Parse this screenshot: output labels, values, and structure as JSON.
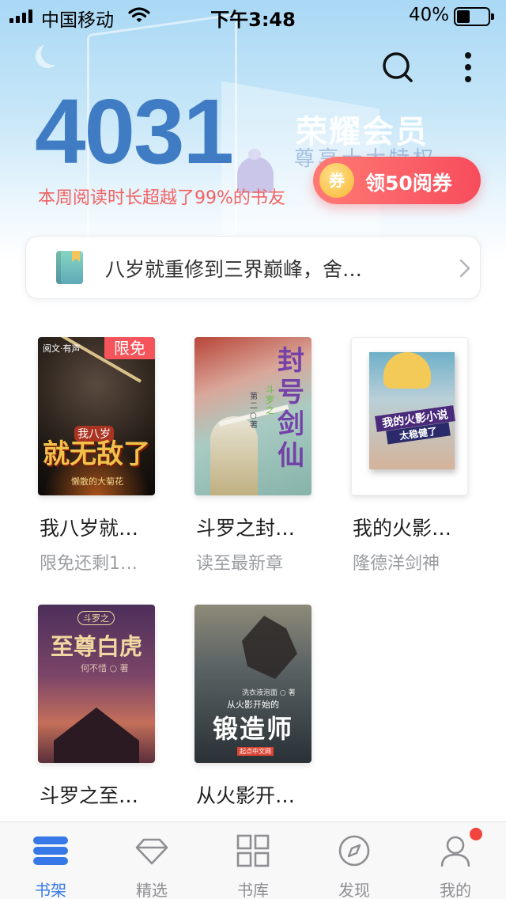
{
  "status_bar": {
    "carrier": "中国移动",
    "time": "下午3:48",
    "battery": "40%"
  },
  "header": {
    "reading_count": "4031",
    "reading_desc": "本周阅读时长超越了99%的书友",
    "member_title": "荣耀会员",
    "member_sub": "尊享十大特权",
    "coupon_icon_text": "券",
    "coupon_label": "领50阅券"
  },
  "recent": {
    "text": "八岁就重修到三界巅峰，舍…"
  },
  "books": [
    {
      "title": "我八岁就…",
      "sub": "限免还剩1…",
      "badge": "限免",
      "cover_title": "就无敌了",
      "cover_small": "我八岁",
      "cover_author": "懒散的大菊花",
      "cover_logo": "阅文·有声"
    },
    {
      "title": "斗罗之封…",
      "sub": "读至最新章",
      "cover_title": "封号剑仙",
      "cover_small": "斗罗之",
      "cover_author": "第二○著"
    },
    {
      "title": "我的火影…",
      "sub": "隆德洋剑神",
      "cover_title": "我的火影小说",
      "cover_small": "太稳健了"
    },
    {
      "title": "斗罗之至…",
      "sub": "何不惜",
      "cover_title": "至尊白虎",
      "cover_small": "斗罗之",
      "cover_author": "何不惜 ○ 著"
    },
    {
      "title": "从火影开…",
      "sub": "洗衣液泡面",
      "cover_title": "锻造师",
      "cover_small": "从火影开始的",
      "cover_author": "洗衣液泡面 ○ 著",
      "cover_publisher": "起点中文网"
    }
  ],
  "tabs": [
    {
      "label": "书架",
      "icon": "bookshelf-icon",
      "active": true
    },
    {
      "label": "精选",
      "icon": "diamond-icon",
      "active": false
    },
    {
      "label": "书库",
      "icon": "grid-icon",
      "active": false
    },
    {
      "label": "发现",
      "icon": "compass-icon",
      "active": false
    },
    {
      "label": "我的",
      "icon": "user-icon",
      "active": false
    }
  ],
  "colors": {
    "accent": "#3678e8",
    "count": "#3f7cc4",
    "coupon": "#f74c5c",
    "badge": "#f4545a",
    "notification_dot": "#f2453d"
  }
}
